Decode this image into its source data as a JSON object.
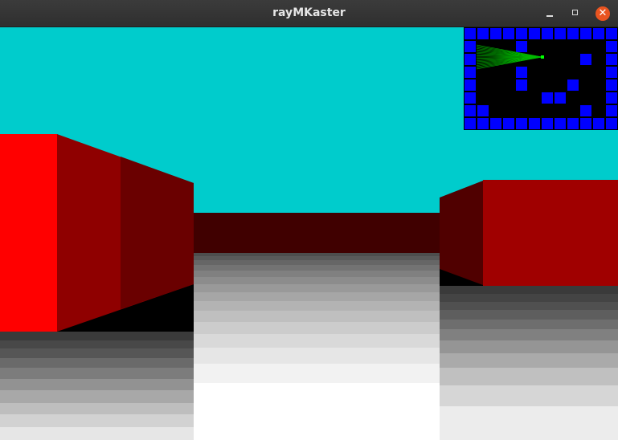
{
  "window": {
    "title": "rayMKaster",
    "controls": {
      "minimize": "minimize-icon",
      "maximize": "maximize-icon",
      "close": "close-icon",
      "close_glyph": "✕"
    }
  },
  "colors": {
    "sky": "#00cccc",
    "wall_front": "#ff0000",
    "wall_side": "#a00000",
    "wall_far": "#400000",
    "minimap_wall": "#0000ff",
    "minimap_floor": "#000000",
    "minimap_player": "#00ff00",
    "minimap_rays": "#00bb00"
  },
  "minimap": {
    "grid": [
      "111111111111",
      "100010000001",
      "100000000101",
      "100010000001",
      "100010001001",
      "100000110001",
      "110000000101",
      "111111111111"
    ]
  }
}
